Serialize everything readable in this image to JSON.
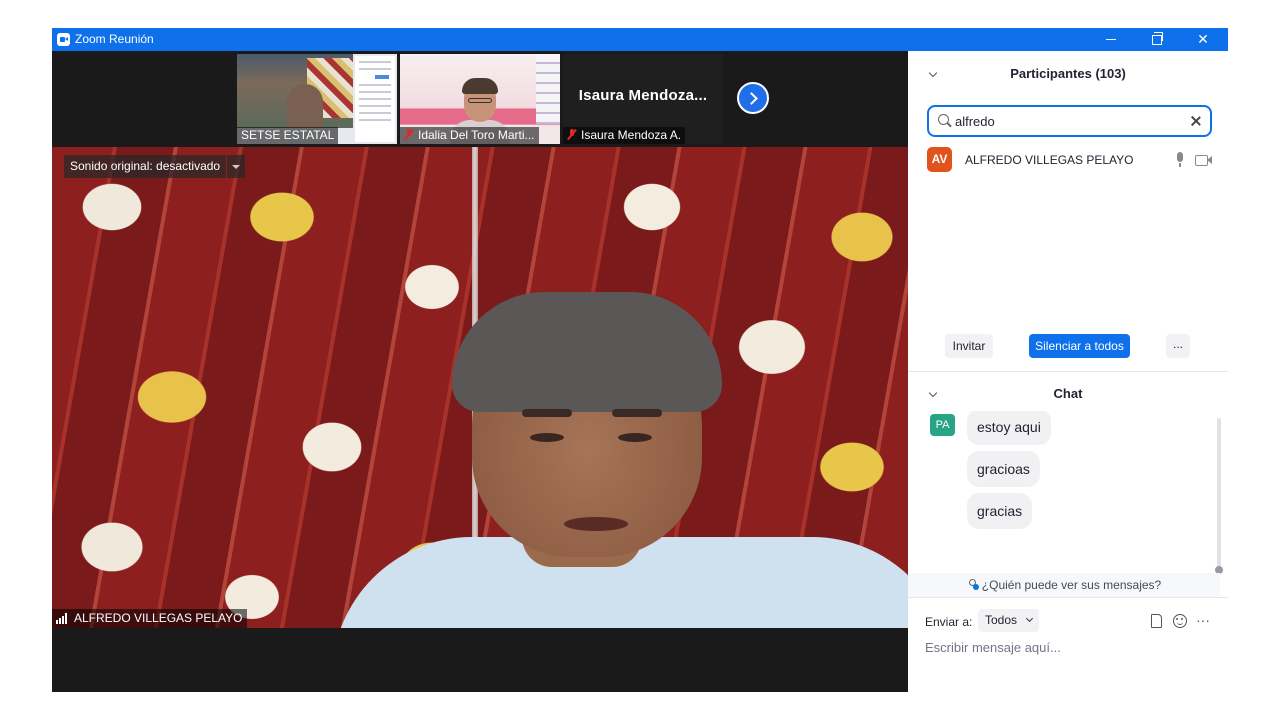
{
  "window": {
    "title": "Zoom Reunión",
    "accent": "#0e71eb"
  },
  "thumbnails": [
    {
      "name": "SETSE ESTATAL",
      "muted": false
    },
    {
      "name": "Idalia Del Toro Marti...",
      "muted": true
    },
    {
      "name": "Isaura Mendoza A.",
      "display_name": "Isaura  Mendoza...",
      "muted": true
    }
  ],
  "main_video": {
    "original_sound": "Sonido original: desactivado",
    "speaker": "ALFREDO VILLEGAS PELAYO"
  },
  "participants": {
    "title": "Participantes (103)",
    "search_value": "alfredo",
    "items": [
      {
        "initials": "AV",
        "name": "ALFREDO VILLEGAS PELAYO",
        "avatar_color": "#e0531c"
      }
    ],
    "buttons": {
      "invite": "Invitar",
      "mute_all": "Silenciar a todos",
      "more": "..."
    }
  },
  "chat": {
    "title": "Chat",
    "sender_initials": "PA",
    "messages": [
      "estoy aqui",
      "gracioas",
      "gracias"
    ],
    "who_can_see": "¿Quién puede ver sus mensajes?",
    "send_to_label": "Enviar a:",
    "send_to_value": "Todos",
    "input_placeholder": "Escribir mensaje aquí...",
    "more_glyph": "···"
  }
}
